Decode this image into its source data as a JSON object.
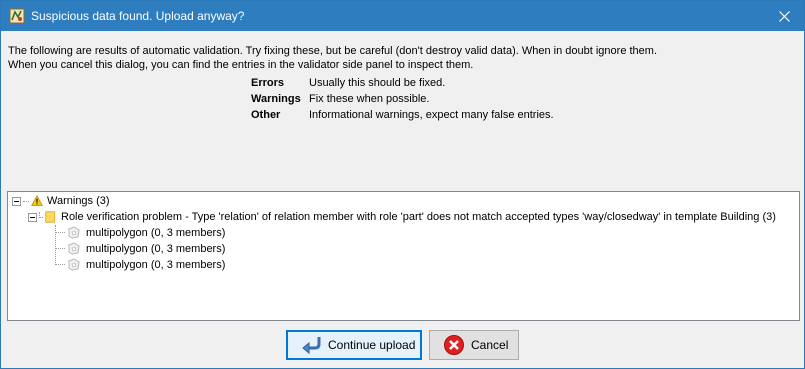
{
  "window": {
    "title": "Suspicious data found. Upload anyway?",
    "close_glyph": "✕"
  },
  "intro": {
    "line1": "The following are results of automatic validation. Try fixing these, but be careful (don't destroy valid data). When in doubt ignore them.",
    "line2": "When you cancel this dialog, you can find the entries in the validator side panel to inspect them."
  },
  "legend": [
    {
      "key": "Errors",
      "desc": "Usually this should be fixed."
    },
    {
      "key": "Warnings",
      "desc": "Fix these when possible."
    },
    {
      "key": "Other",
      "desc": "Informational warnings, expect many false entries."
    }
  ],
  "tree": {
    "root": {
      "label": "Warnings (3)",
      "icon": "warning-icon"
    },
    "group": {
      "label": "Role verification problem - Type 'relation' of relation member with role 'part' does not match accepted types 'way/closedway' in template Building (3)",
      "icon": "folder-icon"
    },
    "items": [
      {
        "label": "multipolygon (0, 3 members)",
        "icon": "multipolygon-icon"
      },
      {
        "label": "multipolygon (0, 3 members)",
        "icon": "multipolygon-icon"
      },
      {
        "label": "multipolygon (0, 3 members)",
        "icon": "multipolygon-icon"
      }
    ]
  },
  "buttons": {
    "continue_label": "Continue upload",
    "cancel_label": "Cancel"
  },
  "colors": {
    "titlebar": "#2d7dbf",
    "accent": "#0078d7"
  }
}
